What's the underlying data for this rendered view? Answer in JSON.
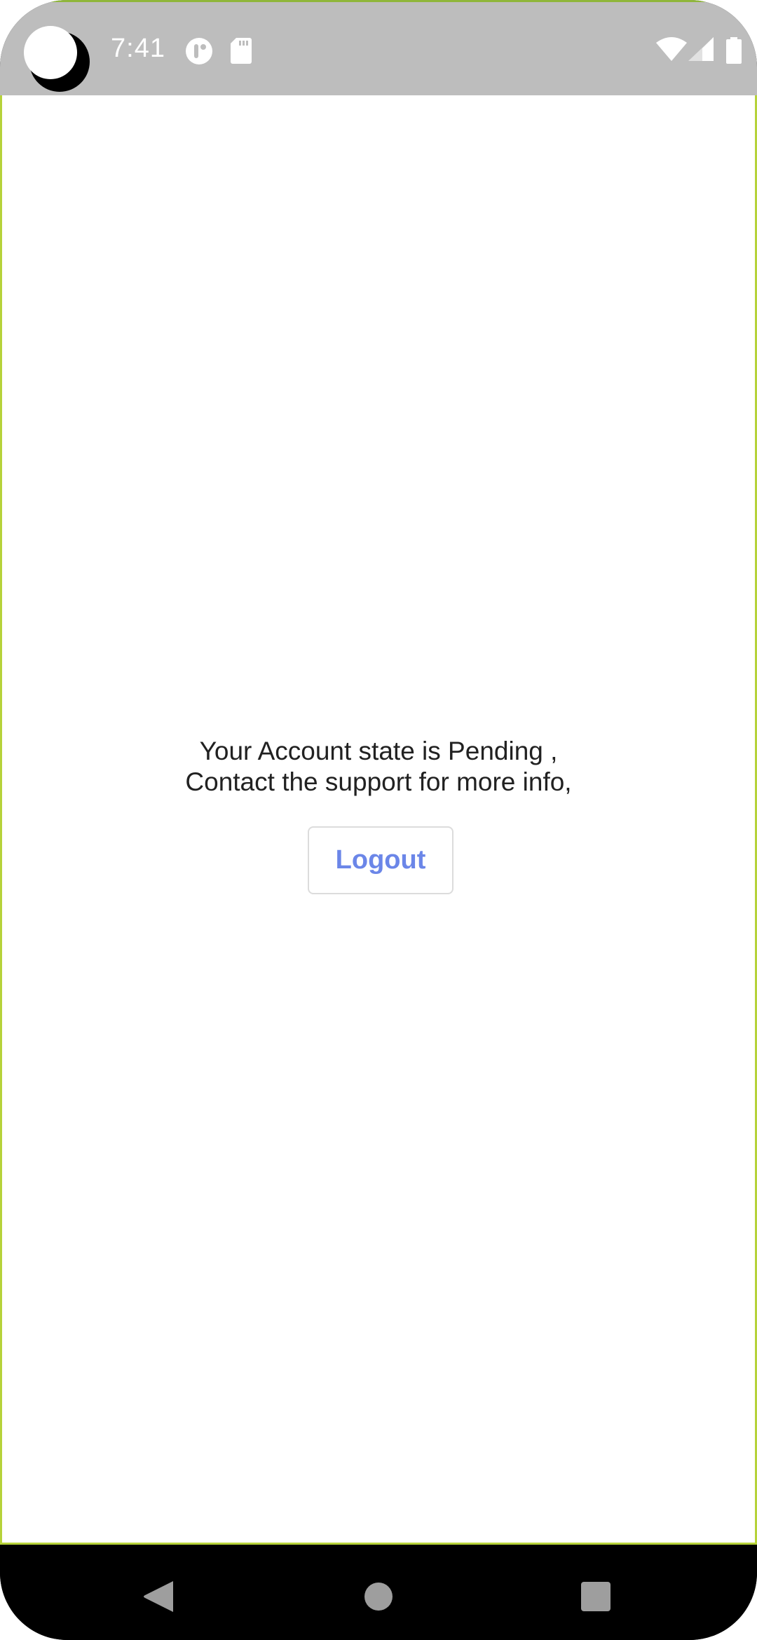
{
  "status_bar": {
    "time": "7:41",
    "icons": [
      "camera-cutout",
      "app-notification-icon",
      "sd-card-icon",
      "wifi-icon",
      "signal-icon",
      "battery-icon"
    ]
  },
  "main": {
    "message_line1": "Your Account state is Pending ,",
    "message_line2": "Contact the support for more info,",
    "logout_label": "Logout"
  },
  "nav_bar": {
    "buttons": [
      "back-icon",
      "home-icon",
      "recents-icon"
    ]
  },
  "colors": {
    "status_bar_bg": "#bdbdbd",
    "accent_border": "#b6d23a",
    "logout_text": "#6b86e8",
    "message_text": "#212121",
    "nav_bar_bg": "#000000"
  }
}
